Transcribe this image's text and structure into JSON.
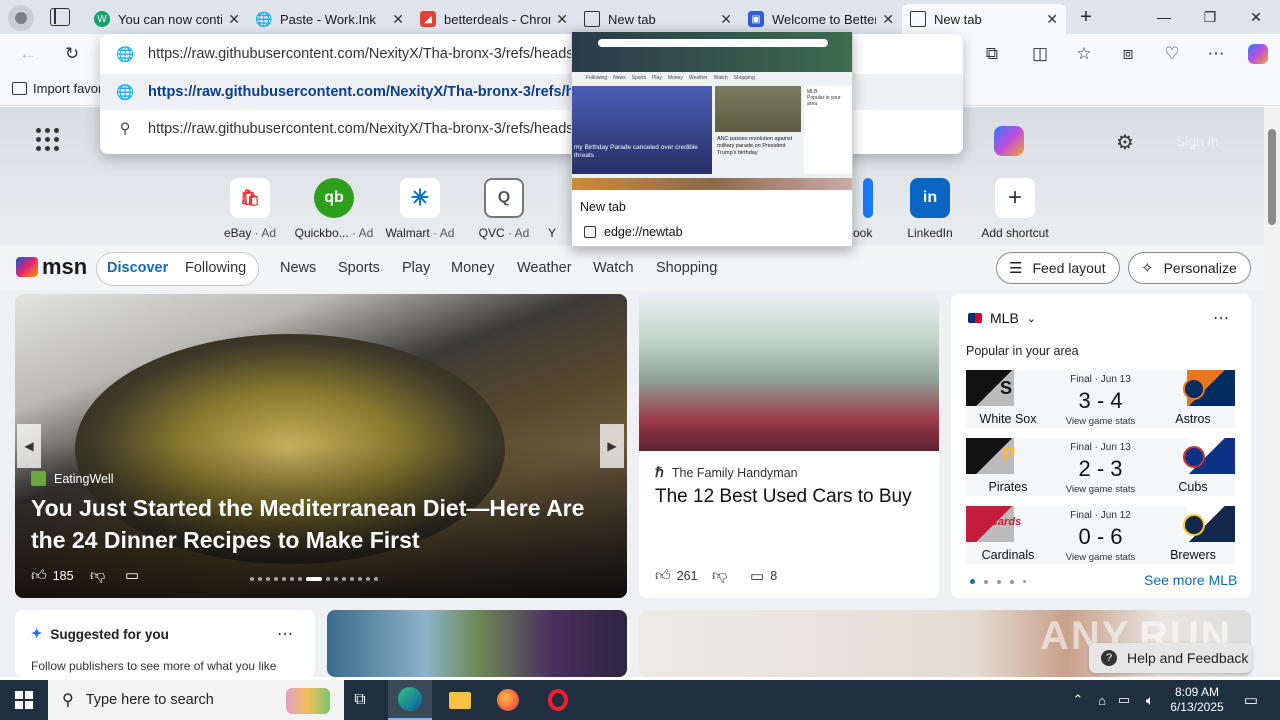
{
  "tabs": [
    {
      "title": "You can now contin",
      "active": false
    },
    {
      "title": "Paste - Work.Ink",
      "active": false
    },
    {
      "title": "betterdeals - Chron",
      "active": false
    },
    {
      "title": "New tab",
      "active": false
    },
    {
      "title": "Welcome to Better!",
      "active": false
    },
    {
      "title": "New tab",
      "active": true
    }
  ],
  "omnibox": {
    "input_value": "https://raw.githubusercontent.com/NexityX/Tha-bronx-3/refs/heads/",
    "suggestions": [
      "https://raw.githubusercontent.com/NexityX/Tha-bronx-3/refs/h",
      "https://raw.githubusercontent.com/NexityX/Tha-bronx-3/refs/heads/"
    ]
  },
  "favorites_bar": {
    "import": "Import favor"
  },
  "tab_preview": {
    "title": "New tab",
    "url": "edge://newtab",
    "thumb_text": {
      "story1": "my Birthday Parade canceled over credible threats",
      "story2": "ANC passes resolution against military parade on President Trump's birthday",
      "nav": [
        "Following",
        "News",
        "Sports",
        "Play",
        "Money",
        "Weather",
        "Watch",
        "Shopping"
      ],
      "sidebar": [
        "MLB",
        "Popular in your area"
      ]
    }
  },
  "search": {
    "sign_in": "Sign in"
  },
  "shortcuts": [
    {
      "name": "eBay",
      "ad": "· Ad",
      "glyph": "🛍",
      "color": "#e53238"
    },
    {
      "name": "Quickbo...",
      "ad": "· Ad",
      "glyph": "qb",
      "color": "#2ca01c"
    },
    {
      "name": "Walmart",
      "ad": "· Ad",
      "glyph": "✳",
      "color": "#0071ce"
    },
    {
      "name": "QVC",
      "ad": "· Ad",
      "glyph": "Q",
      "color": "#555555"
    },
    {
      "name": "Y",
      "ad": "",
      "glyph": "",
      "color": "#ffffff"
    },
    {
      "name": "ook",
      "ad": "",
      "glyph": "",
      "color": "#1877f2"
    },
    {
      "name": "LinkedIn",
      "ad": "",
      "glyph": "in",
      "color": "#0a66c2"
    },
    {
      "name": "Add shortcut",
      "ad": "",
      "glyph": "+",
      "color": "#333333"
    }
  ],
  "msn": {
    "logo": "msn",
    "tabs": [
      "Discover",
      "Following"
    ],
    "nav": [
      "News",
      "Sports",
      "Play",
      "Money",
      "Weather",
      "Watch",
      "Shopping"
    ],
    "feed_layout": "Feed layout",
    "personalize": "Personalize"
  },
  "main_story": {
    "source": "EatingWell",
    "headline": "You Just Started the Mediterranean Diet—Here Are the 24 Dinner Recipes to Make First",
    "likes": "185"
  },
  "side_story": {
    "source": "The Family Handyman",
    "headline": "The 12 Best Used Cars to Buy",
    "likes": "261",
    "comments": "8"
  },
  "mlb": {
    "league": "MLB",
    "subtitle": "Popular in your area",
    "games": [
      {
        "status": "Final · Jun 13",
        "score": "3 - 4",
        "home": "White Sox",
        "away": "Astros",
        "link": "View game stats",
        "home_color": "#111111",
        "away_color": "#002d62"
      },
      {
        "status": "Final · Jun 13",
        "score": "2 - 3",
        "home": "Pirates",
        "away": "Cubs",
        "link": "View game stats",
        "home_color": "#111111",
        "away_color": "#0e3386"
      },
      {
        "status": "Final · Jun 12",
        "score": "0 - 6",
        "home": "Cardinals",
        "away": "Brewers",
        "link": "View game stats",
        "home_color": "#c41e3a",
        "away_color": "#12284b"
      }
    ],
    "see_more": "See more MLB"
  },
  "suggested": {
    "title": "Suggested for you",
    "body": "Follow publishers to see more of what you like"
  },
  "watermark": "ANY.RUN",
  "help": "Help and Feedback",
  "taskbar": {
    "search_placeholder": "Type here to search",
    "time": "8:09 AM",
    "date": "6/13/2025"
  }
}
